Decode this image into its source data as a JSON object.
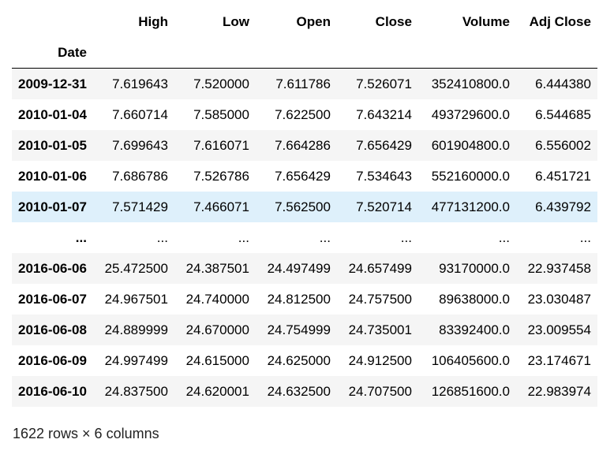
{
  "table": {
    "columns": [
      "High",
      "Low",
      "Open",
      "Close",
      "Volume",
      "Adj Close"
    ],
    "index_name": "Date",
    "rows": [
      {
        "date": "2009-12-31",
        "values": [
          "7.619643",
          "7.520000",
          "7.611786",
          "7.526071",
          "352410800.0",
          "6.444380"
        ]
      },
      {
        "date": "2010-01-04",
        "values": [
          "7.660714",
          "7.585000",
          "7.622500",
          "7.643214",
          "493729600.0",
          "6.544685"
        ]
      },
      {
        "date": "2010-01-05",
        "values": [
          "7.699643",
          "7.616071",
          "7.664286",
          "7.656429",
          "601904800.0",
          "6.556002"
        ]
      },
      {
        "date": "2010-01-06",
        "values": [
          "7.686786",
          "7.526786",
          "7.656429",
          "7.534643",
          "552160000.0",
          "6.451721"
        ]
      },
      {
        "date": "2010-01-07",
        "values": [
          "7.571429",
          "7.466071",
          "7.562500",
          "7.520714",
          "477131200.0",
          "6.439792"
        ]
      },
      {
        "date": "...",
        "values": [
          "...",
          "...",
          "...",
          "...",
          "...",
          "..."
        ]
      },
      {
        "date": "2016-06-06",
        "values": [
          "25.472500",
          "24.387501",
          "24.497499",
          "24.657499",
          "93170000.0",
          "22.937458"
        ]
      },
      {
        "date": "2016-06-07",
        "values": [
          "24.967501",
          "24.740000",
          "24.812500",
          "24.757500",
          "89638000.0",
          "23.030487"
        ]
      },
      {
        "date": "2016-06-08",
        "values": [
          "24.889999",
          "24.670000",
          "24.754999",
          "24.735001",
          "83392400.0",
          "23.009554"
        ]
      },
      {
        "date": "2016-06-09",
        "values": [
          "24.997499",
          "24.615000",
          "24.625000",
          "24.912500",
          "106405600.0",
          "23.174671"
        ]
      },
      {
        "date": "2016-06-10",
        "values": [
          "24.837500",
          "24.620001",
          "24.632500",
          "24.707500",
          "126851600.0",
          "22.983974"
        ]
      }
    ]
  },
  "footer": "1622 rows × 6 columns",
  "colors": {
    "stripe": "#f5f5f5",
    "hover": "#def0fb"
  }
}
